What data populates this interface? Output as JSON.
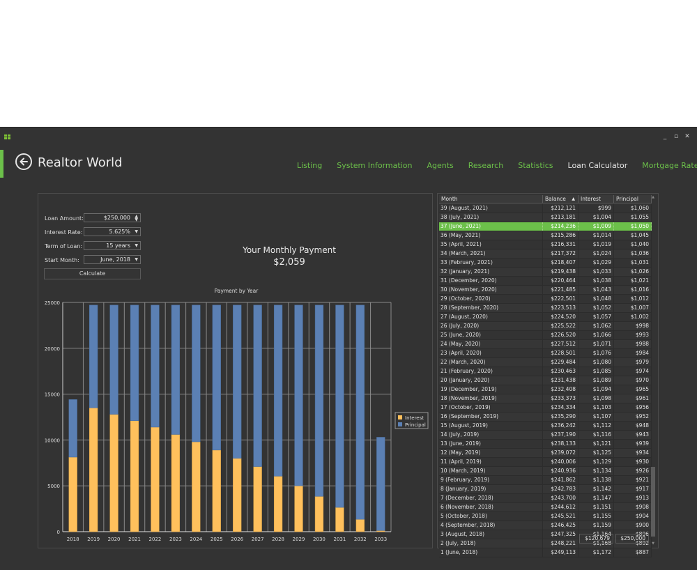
{
  "window": {
    "app_icon": "tiles-icon",
    "controls": [
      "minimize",
      "maximize",
      "close"
    ]
  },
  "header": {
    "back_icon": "back-arrow-circle-icon",
    "title": "Realtor World",
    "nav": [
      {
        "label": "Listing",
        "active": false
      },
      {
        "label": "System Information",
        "active": false
      },
      {
        "label": "Agents",
        "active": false
      },
      {
        "label": "Research",
        "active": false
      },
      {
        "label": "Statistics",
        "active": false
      },
      {
        "label": "Loan Calculator",
        "active": true
      },
      {
        "label": "Mortgage Rates",
        "active": false
      }
    ]
  },
  "form": {
    "loan_amount_label": "Loan Amount:",
    "loan_amount_value": "$250,000",
    "interest_rate_label": "Interest Rate:",
    "interest_rate_value": "5.625%",
    "term_label": "Term of Loan:",
    "term_value": "15 years",
    "start_month_label": "Start Month:",
    "start_month_value": "June, 2018",
    "calculate_label": "Calculate"
  },
  "payment": {
    "title": "Your Monthly Payment",
    "value": "$2,059"
  },
  "colors": {
    "accent": "#6cc04a",
    "interest": "#ffc05c",
    "principal": "#5b80b4",
    "background": "#333333"
  },
  "chart_data": {
    "type": "bar",
    "stacked": true,
    "title": "Payment by Year",
    "xlabel": "",
    "ylabel": "",
    "ylim": [
      0,
      25000
    ],
    "yticks": [
      0,
      5000,
      10000,
      15000,
      20000,
      25000
    ],
    "grid": true,
    "legend_position": "right",
    "categories": [
      "2018",
      "2019",
      "2020",
      "2021",
      "2022",
      "2023",
      "2024",
      "2025",
      "2026",
      "2027",
      "2028",
      "2029",
      "2030",
      "2031",
      "2032",
      "2033"
    ],
    "series": [
      {
        "name": "Interest",
        "values": [
          8130,
          13500,
          12800,
          12100,
          11400,
          10600,
          9800,
          8900,
          8000,
          7100,
          6050,
          5000,
          3850,
          2650,
          1350,
          120
        ]
      },
      {
        "name": "Principal",
        "values": [
          6280,
          11210,
          11910,
          12610,
          13310,
          14110,
          14910,
          15810,
          16710,
          17610,
          18660,
          19710,
          20860,
          22060,
          23360,
          10180
        ]
      }
    ]
  },
  "table": {
    "columns": [
      "Month",
      "Balance",
      "Interest",
      "Principal"
    ],
    "sort_column": "Balance",
    "sort_direction": "ascending",
    "selected_index": 2,
    "rows": [
      [
        "39 (August, 2021)",
        "$212,121",
        "$999",
        "$1,060"
      ],
      [
        "38 (July, 2021)",
        "$213,181",
        "$1,004",
        "$1,055"
      ],
      [
        "37 (June, 2021)",
        "$214,236",
        "$1,009",
        "$1,050"
      ],
      [
        "36 (May, 2021)",
        "$215,286",
        "$1,014",
        "$1,045"
      ],
      [
        "35 (April, 2021)",
        "$216,331",
        "$1,019",
        "$1,040"
      ],
      [
        "34 (March, 2021)",
        "$217,372",
        "$1,024",
        "$1,036"
      ],
      [
        "33 (February, 2021)",
        "$218,407",
        "$1,029",
        "$1,031"
      ],
      [
        "32 (January, 2021)",
        "$219,438",
        "$1,033",
        "$1,026"
      ],
      [
        "31 (December, 2020)",
        "$220,464",
        "$1,038",
        "$1,021"
      ],
      [
        "30 (November, 2020)",
        "$221,485",
        "$1,043",
        "$1,016"
      ],
      [
        "29 (October, 2020)",
        "$222,501",
        "$1,048",
        "$1,012"
      ],
      [
        "28 (September, 2020)",
        "$223,513",
        "$1,052",
        "$1,007"
      ],
      [
        "27 (August, 2020)",
        "$224,520",
        "$1,057",
        "$1,002"
      ],
      [
        "26 (July, 2020)",
        "$225,522",
        "$1,062",
        "$998"
      ],
      [
        "25 (June, 2020)",
        "$226,520",
        "$1,066",
        "$993"
      ],
      [
        "24 (May, 2020)",
        "$227,512",
        "$1,071",
        "$988"
      ],
      [
        "23 (April, 2020)",
        "$228,501",
        "$1,076",
        "$984"
      ],
      [
        "22 (March, 2020)",
        "$229,484",
        "$1,080",
        "$979"
      ],
      [
        "21 (February, 2020)",
        "$230,463",
        "$1,085",
        "$974"
      ],
      [
        "20 (January, 2020)",
        "$231,438",
        "$1,089",
        "$970"
      ],
      [
        "19 (December, 2019)",
        "$232,408",
        "$1,094",
        "$965"
      ],
      [
        "18 (November, 2019)",
        "$233,373",
        "$1,098",
        "$961"
      ],
      [
        "17 (October, 2019)",
        "$234,334",
        "$1,103",
        "$956"
      ],
      [
        "16 (September, 2019)",
        "$235,290",
        "$1,107",
        "$952"
      ],
      [
        "15 (August, 2019)",
        "$236,242",
        "$1,112",
        "$948"
      ],
      [
        "14 (July, 2019)",
        "$237,190",
        "$1,116",
        "$943"
      ],
      [
        "13 (June, 2019)",
        "$238,133",
        "$1,121",
        "$939"
      ],
      [
        "12 (May, 2019)",
        "$239,072",
        "$1,125",
        "$934"
      ],
      [
        "11 (April, 2019)",
        "$240,006",
        "$1,129",
        "$930"
      ],
      [
        "10 (March, 2019)",
        "$240,936",
        "$1,134",
        "$926"
      ],
      [
        "9 (February, 2019)",
        "$241,862",
        "$1,138",
        "$921"
      ],
      [
        "8 (January, 2019)",
        "$242,783",
        "$1,142",
        "$917"
      ],
      [
        "7 (December, 2018)",
        "$243,700",
        "$1,147",
        "$913"
      ],
      [
        "6 (November, 2018)",
        "$244,612",
        "$1,151",
        "$908"
      ],
      [
        "5 (October, 2018)",
        "$245,521",
        "$1,155",
        "$904"
      ],
      [
        "4 (September, 2018)",
        "$246,425",
        "$1,159",
        "$900"
      ],
      [
        "3 (August, 2018)",
        "$247,325",
        "$1,164",
        "$896"
      ],
      [
        "2 (July, 2018)",
        "$248,221",
        "$1,168",
        "$892"
      ],
      [
        "1 (June, 2018)",
        "$249,113",
        "$1,172",
        "$887"
      ]
    ],
    "totals": {
      "interest": "$120,679",
      "principal": "$250,000"
    }
  }
}
